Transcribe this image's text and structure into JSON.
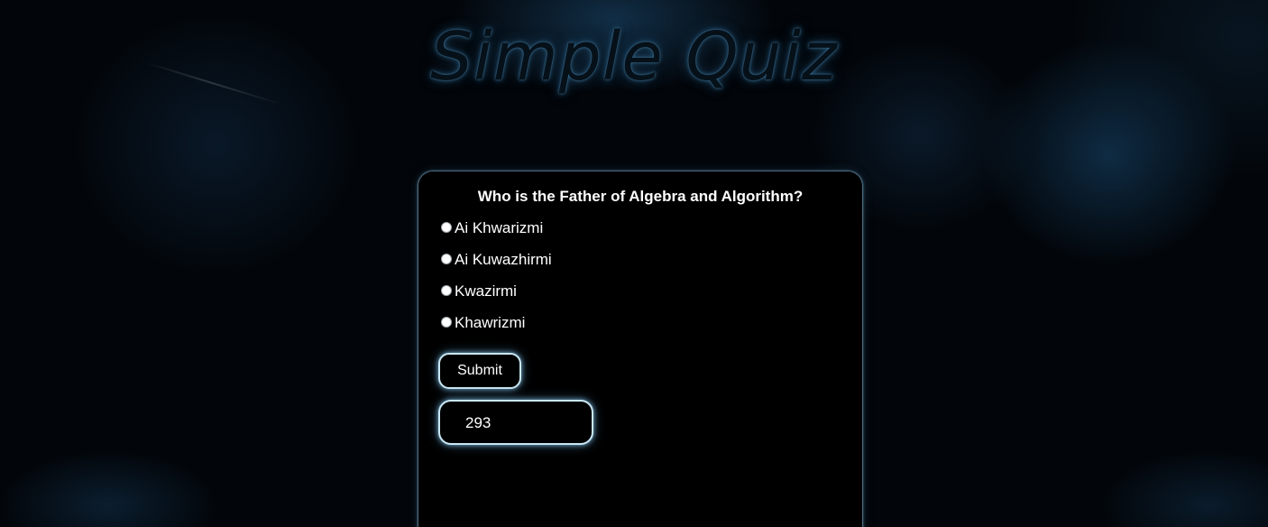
{
  "page": {
    "title": "Simple Quiz"
  },
  "quiz": {
    "question": "Who is the Father of Algebra and Algorithm?",
    "options": [
      {
        "label": "Ai Khwarizmi",
        "selected": false
      },
      {
        "label": "Ai Kuwazhirmi",
        "selected": false
      },
      {
        "label": "Kwazirmi",
        "selected": false
      },
      {
        "label": "Khawrizmi",
        "selected": false
      }
    ],
    "submit_label": "Submit",
    "score_value": "293"
  },
  "colors": {
    "background": "#02050a",
    "card": "#000000",
    "glow": "#c9e7f5",
    "text": "#ffffff"
  }
}
